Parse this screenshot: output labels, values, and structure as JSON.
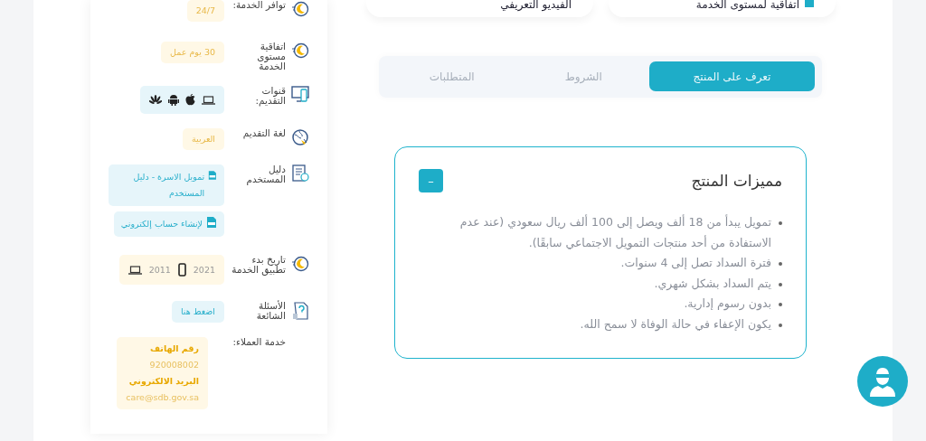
{
  "top_cards": [
    {
      "label": "اتفاقية لمستوى الخدمة",
      "kind": "marked"
    },
    {
      "label": "الفيديو التعريفي",
      "kind": "plain"
    }
  ],
  "sidebar": {
    "items": [
      {
        "kind": "chip",
        "label": "توافر الخدمة:",
        "value": "24/7"
      },
      {
        "kind": "chip",
        "label": "اتفاقية مستوى الخدمة",
        "value": "30 يوم عمل"
      },
      {
        "kind": "platforms",
        "label": "قنوات التقديم:"
      },
      {
        "kind": "chip",
        "label": "لغة التقديم",
        "value": "العربية"
      },
      {
        "kind": "links",
        "label": "دليل المستخدم",
        "links": [
          "تمويل الاسرة - دليل المستخدم",
          "لإنشاء حساب إلكتروني"
        ]
      },
      {
        "kind": "dates",
        "label": "تاريخ بدء تطبيق الخدمة",
        "dates": [
          "2021",
          "2011"
        ]
      },
      {
        "kind": "link",
        "label": "الأسئلة الشائعة",
        "value": "اضغط هنا"
      },
      {
        "kind": "contact",
        "label": "خدمة العملاء:",
        "lines": [
          {
            "text": "رقم الهاتف",
            "kind": "heading"
          },
          {
            "text": "920008002",
            "kind": "value"
          },
          {
            "text": "البريد الالكتروني",
            "kind": "heading"
          },
          {
            "text": "care@sdb.gov.sa",
            "kind": "value"
          }
        ]
      }
    ]
  },
  "tabs": [
    {
      "label": "تعرف على المنتج",
      "selected": true
    },
    {
      "label": "الشروط",
      "selected": false
    },
    {
      "label": "المتطلبات",
      "selected": false
    }
  ],
  "accordion": {
    "title": "مميزات المنتج",
    "toggle": "–",
    "expanded": true,
    "items": [
      "تمويل يبدأ من 18 ألف ويصل إلى 100 ألف ريال سعودي (عند عدم الاستفادة من أحد منتجات التمويل الاجتماعي سابقًا).",
      "فترة السداد تصل إلى 4 سنوات.",
      "يتم السداد بشكل شهري.",
      "بدون رسوم إدارية.",
      "يكون الإعفاء في حالة الوفاة لا سمح الله."
    ]
  }
}
